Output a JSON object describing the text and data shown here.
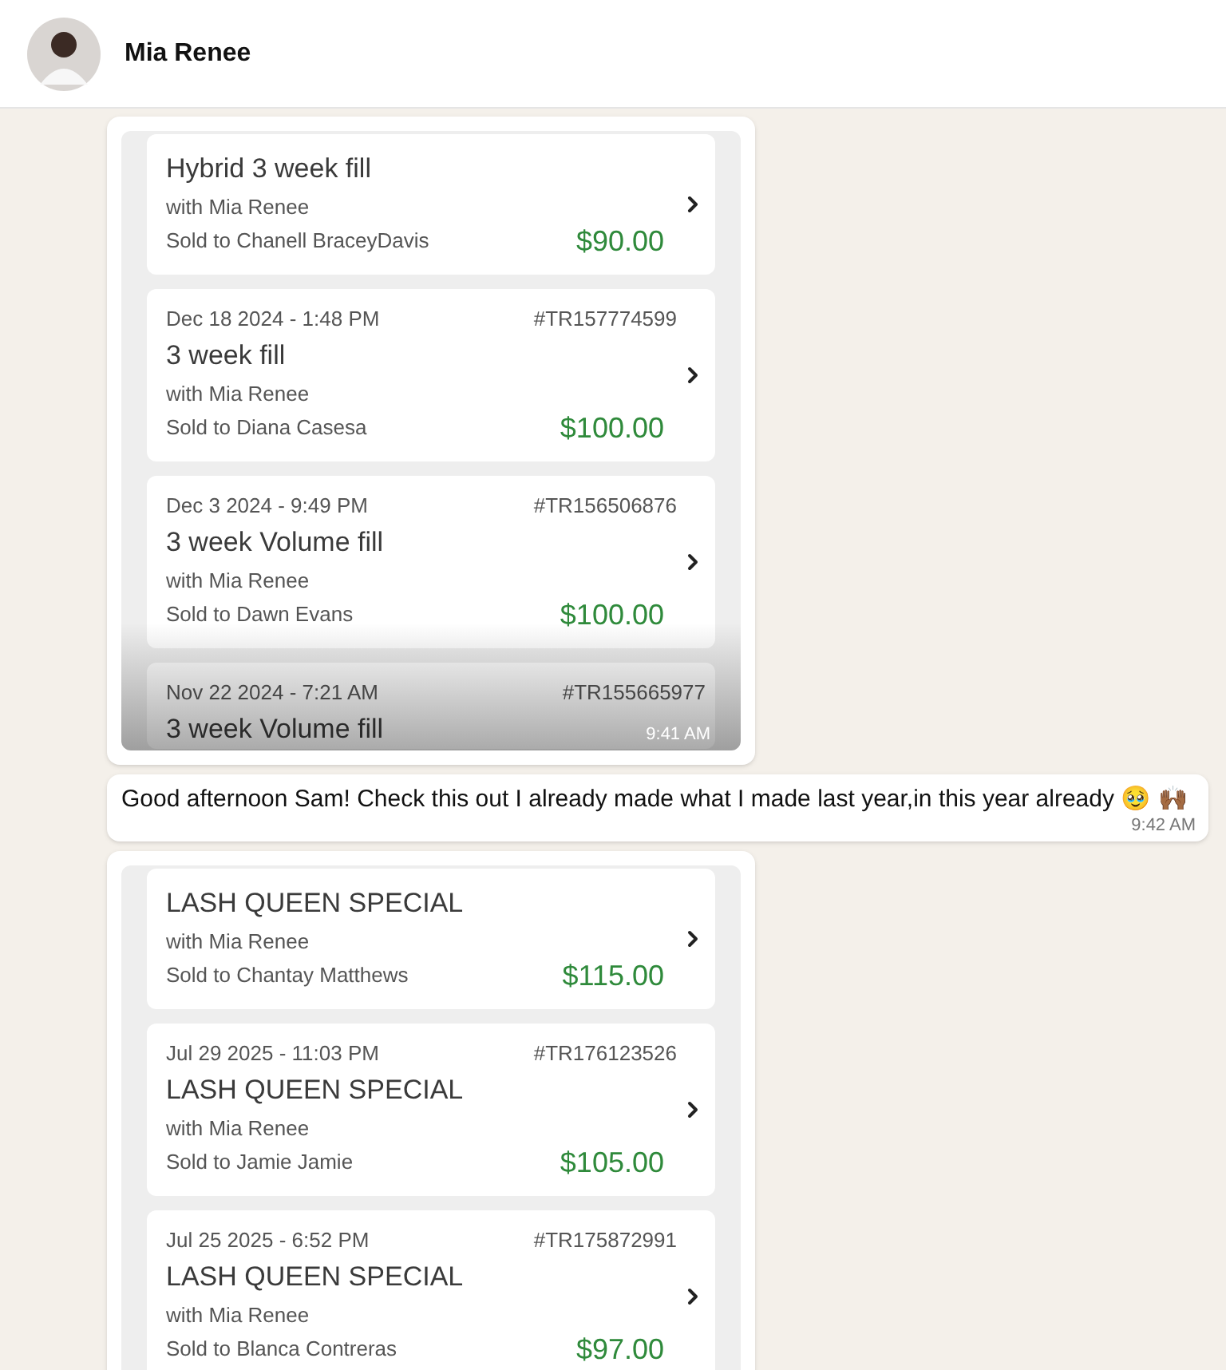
{
  "contact": {
    "name": "Mia Renee"
  },
  "messages": [
    {
      "kind": "image",
      "time": "9:41 AM",
      "cards": [
        {
          "title": "Hybrid 3 week fill",
          "with": "with Mia Renee",
          "sold_to": "Sold to Chanell BraceyDavis",
          "price": "$90.00"
        },
        {
          "date": "Dec 18 2024 - 1:48 PM",
          "id": "#TR157774599",
          "title": "3 week fill",
          "with": "with Mia Renee",
          "sold_to": "Sold to Diana Casesa",
          "price": "$100.00"
        },
        {
          "date": "Dec 3 2024 - 9:49 PM",
          "id": "#TR156506876",
          "title": "3 week Volume fill",
          "with": "with Mia Renee",
          "sold_to": "Sold to Dawn Evans",
          "price": "$100.00"
        },
        {
          "date": "Nov 22 2024 - 7:21 AM",
          "id": "#TR155665977",
          "title": "3 week Volume fill"
        }
      ]
    },
    {
      "kind": "text",
      "text": "Good afternoon Sam! Check this out I already made what I made last year,in this year already 🥹 🙌🏾",
      "time": "9:42 AM"
    },
    {
      "kind": "image",
      "cards": [
        {
          "title": "LASH QUEEN SPECIAL",
          "with": "with Mia Renee",
          "sold_to": "Sold to Chantay Matthews",
          "price": "$115.00"
        },
        {
          "date": "Jul 29 2025 - 11:03 PM",
          "id": "#TR176123526",
          "title": "LASH QUEEN SPECIAL",
          "with": "with Mia Renee",
          "sold_to": "Sold to Jamie Jamie",
          "price": "$105.00"
        },
        {
          "date": "Jul 25 2025 - 6:52 PM",
          "id": "#TR175872991",
          "title": "LASH QUEEN SPECIAL",
          "with": "with Mia Renee",
          "sold_to": "Sold to Blanca Contreras",
          "price": "$97.00"
        }
      ]
    }
  ]
}
